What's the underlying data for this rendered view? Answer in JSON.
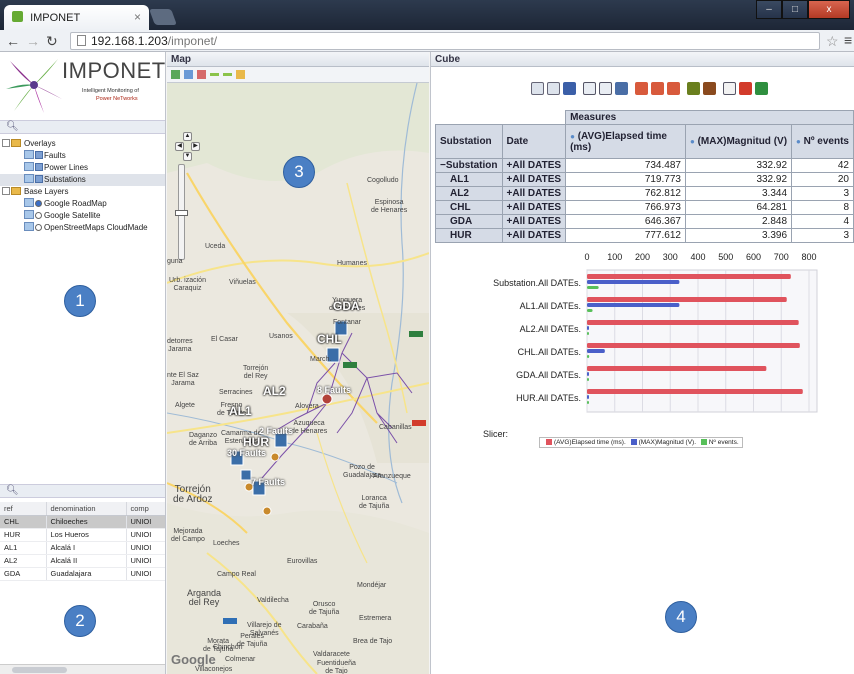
{
  "browser": {
    "tab_title": "IMPONET",
    "tab_close": "×",
    "url_host": "192.168.1.203",
    "url_path": "/imponet/",
    "window_buttons": [
      "–",
      "□",
      "x"
    ]
  },
  "logo": {
    "name": "IMPONET",
    "subtitle": "Intelligent Monitoring of",
    "subtitle2": "Power NeTworks"
  },
  "tree": {
    "overlays": "Overlays",
    "faults": "Faults",
    "power_lines": "Power Lines",
    "substations": "Substations",
    "base_layers": "Base Layers",
    "google_roadmap": "Google RoadMap",
    "google_satellite": "Google Satellite",
    "osm": "OpenStreetMaps CloudMade"
  },
  "grid": {
    "columns": [
      "ref",
      "denomination",
      "comp"
    ],
    "rows": [
      {
        "ref": "CHL",
        "name": "Chiloeches",
        "comp": "UNIOI"
      },
      {
        "ref": "HUR",
        "name": "Los Hueros",
        "comp": "UNIOI"
      },
      {
        "ref": "AL1",
        "name": "Alcalá I",
        "comp": "UNIOI"
      },
      {
        "ref": "AL2",
        "name": "Alcalá II",
        "comp": "UNIOI"
      },
      {
        "ref": "GDA",
        "name": "Guadalajara",
        "comp": "UNIOI"
      }
    ]
  },
  "map": {
    "title": "Map",
    "places": {
      "cogolludo": "Cogolludo",
      "espinosa": "Espinosa\nde Henares",
      "uceda": "Uceda",
      "guna": "guna",
      "humanes": "Humanes",
      "urbanizacion": "Urb. ización\nCaraquiz",
      "vinuelas": "Viñuelas",
      "yunquera": "Yunquera\nde Henares",
      "fontanar": "Fontanar",
      "usanos": "Usanos",
      "elcasar": "El Casar",
      "detorres": "detorres\nJarama",
      "eltsaz": "nte El Saz\nJarama",
      "torrejondelrey": "Torrejón\ndel Rey",
      "marchamalo": "March.",
      "algete": "Algete",
      "serranillos": "Serracines",
      "fresno": "Fresno\nde Torote",
      "alovera": "Alovera",
      "azuqueca": "Azuqueca\nde Henares",
      "daganzo": "Daganzo\nde Arriba",
      "camarma": "Camarma de\nEsteruelas",
      "cabanillas": "Cabanillas",
      "pozo": "Pozo de\nGuadalajara",
      "arauzeque": "Aranzueque",
      "lorangue": "Loranca\nde Tajuña",
      "torrejondeardoz": "Torrejón\nde Ardoz",
      "mejorada": "Mejorada\ndel Campo",
      "loeches": "Loeches",
      "eurovillas": "Eurovillas",
      "camporeal": "Campo Real",
      "arganda": "Arganda\ndel Rey",
      "valdilecha": "Valdilecha",
      "orusco": "Orusco\nde Tajuña",
      "mondejar": "Mondéjar",
      "carabana": "Carabaña",
      "perales": "Perales\nde Tajuña",
      "morata": "Morata\nde Tajuña",
      "bread": "Brea de Tajo",
      "valdaracete": "Valdaracete",
      "estremera": "Estremera",
      "villarejo": "Villarejo de\nSalvanés",
      "chinchon": "Chinchón",
      "colmenar": "Colmenar",
      "fuentiduena": "Fuentidueña\nde Tajo",
      "villaconejos": "Villaconejos"
    },
    "sites": {
      "gda": "GDA",
      "chl": "CHL",
      "al2": "AL2",
      "al1": "AL1",
      "hur": "HUR"
    },
    "faults": {
      "f1": "8 Faults",
      "f2": "2 Faults",
      "f3": "30 Faults",
      "f4": "7 Faults"
    },
    "google": "Google"
  },
  "cube": {
    "title": "Cube",
    "header_measures": "Measures",
    "col_substation": "Substation",
    "col_date": "Date",
    "col_elapsed": "(AVG)Elapsed time (ms)",
    "col_magnitud": "(MAX)Magnitud (V)",
    "col_events": "Nº events",
    "rows": [
      {
        "sub": "−Substation",
        "date": "+All DATES",
        "elapsed": "734.487",
        "mag": "332.92",
        "ev": "42"
      },
      {
        "sub": "AL1",
        "date": "+All DATES",
        "elapsed": "719.773",
        "mag": "332.92",
        "ev": "20"
      },
      {
        "sub": "AL2",
        "date": "+All DATES",
        "elapsed": "762.812",
        "mag": "3.344",
        "ev": "3"
      },
      {
        "sub": "CHL",
        "date": "+All DATES",
        "elapsed": "766.973",
        "mag": "64.281",
        "ev": "8"
      },
      {
        "sub": "GDA",
        "date": "+All DATES",
        "elapsed": "646.367",
        "mag": "2.848",
        "ev": "4"
      },
      {
        "sub": "HUR",
        "date": "+All DATES",
        "elapsed": "777.612",
        "mag": "3.396",
        "ev": "3"
      }
    ],
    "slicer": "Slicer:"
  },
  "chart_data": {
    "type": "bar",
    "orientation": "horizontal",
    "categories": [
      "Substation.All DATEs.",
      "AL1.All DATEs.",
      "AL2.All DATEs.",
      "CHL.All DATEs.",
      "GDA.All DATEs.",
      "HUR.All DATEs."
    ],
    "series": [
      {
        "name": "(AVG)Elapsed time (ms).",
        "values": [
          734.487,
          719.773,
          762.812,
          766.973,
          646.367,
          777.612
        ]
      },
      {
        "name": "(MAX)Magnitud (V).",
        "values": [
          332.92,
          332.92,
          3.344,
          64.281,
          2.848,
          3.396
        ]
      },
      {
        "name": "Nº events.",
        "values": [
          42,
          20,
          3,
          8,
          4,
          3
        ]
      }
    ],
    "xticks": [
      0,
      100,
      200,
      300,
      400,
      500,
      600,
      700,
      800
    ],
    "xlim": [
      0,
      800
    ],
    "legend": "bottom",
    "colors": [
      "#e0535d",
      "#4a5fc9",
      "#58c05a"
    ]
  },
  "badges": [
    "1",
    "2",
    "3",
    "4"
  ]
}
